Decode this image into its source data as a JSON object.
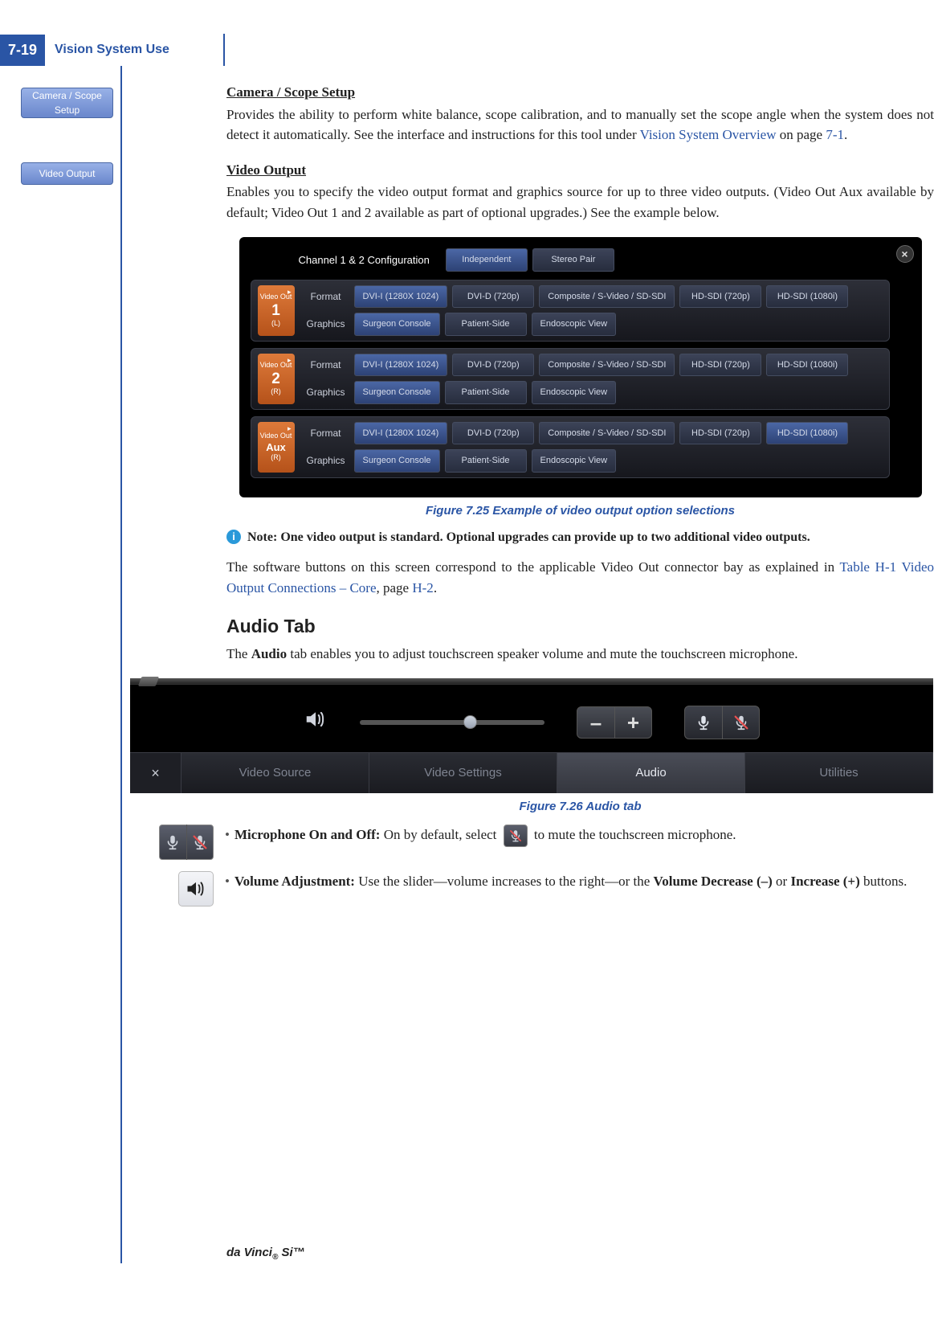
{
  "header": {
    "page_number": "7-19",
    "section": "Vision System Use"
  },
  "ui_buttons": {
    "camera_scope": "Camera / Scope Setup",
    "video_output": "Video Output"
  },
  "camera_block": {
    "heading": "Camera / Scope Setup",
    "text_before_link": "Provides the ability to perform white balance, scope calibration, and to manually set the scope angle when the system does not detect it automatically. See the interface and instructions for this tool under ",
    "link": "Vision System Overview",
    "text_mid": " on page ",
    "page_ref": "7-1",
    "text_after": "."
  },
  "video_block": {
    "heading": "Video Output",
    "text": "Enables you to specify the video output format and graphics source for up to three video outputs. (Video Out Aux available by default; Video Out 1 and 2 available as part of optional upgrades.) See the example below."
  },
  "video_panel": {
    "config_label": "Channel 1 & 2 Configuration",
    "config_options": [
      "Independent",
      "Stereo Pair"
    ],
    "channels": [
      {
        "badge_top": "Video Out",
        "badge_num": "1",
        "badge_sub": "(L)"
      },
      {
        "badge_top": "Video Out",
        "badge_num": "2",
        "badge_sub": "(R)"
      },
      {
        "badge_top": "Video Out",
        "badge_num": "Aux",
        "badge_sub": "(R)"
      }
    ],
    "row_labels": {
      "format": "Format",
      "graphics": "Graphics"
    },
    "format_options": [
      "DVI-I (1280X 1024)",
      "DVI-D (720p)",
      "Composite / S-Video / SD-SDI",
      "HD-SDI (720p)",
      "HD-SDI (1080i)"
    ],
    "graphics_options": [
      "Surgeon Console",
      "Patient-Side",
      "Endoscopic View"
    ],
    "close": "×"
  },
  "fig25_caption": "Figure 7.25 Example of video output option selections",
  "note": {
    "icon": "i",
    "text": "Note: One video output is standard. Optional upgrades can provide up to two additional video outputs."
  },
  "after_note": {
    "text_before": "The software buttons on this screen correspond to the applicable Video Out connector bay as explained in ",
    "link": "Table H-1 Video Output Connections – Core",
    "text_mid": ", page ",
    "page_ref": "H-2",
    "text_after": "."
  },
  "audio_section": {
    "heading": "Audio Tab",
    "intro_before": "The ",
    "intro_bold": "Audio",
    "intro_after": " tab enables you to adjust touchscreen speaker volume and mute the touchscreen microphone."
  },
  "audio_panel": {
    "vol_minus": "–",
    "vol_plus": "+",
    "close": "×",
    "tabs": [
      "Video Source",
      "Video Settings",
      "Audio",
      "Utilities"
    ],
    "active_tab_index": 2
  },
  "fig26_caption": "Figure 7.26 Audio tab",
  "bullets": {
    "mic": {
      "label": "Microphone On and Off:",
      "before": " On by default, select ",
      "after": " to mute the touchscreen microphone."
    },
    "vol": {
      "label": "Volume Adjustment:",
      "before": " Use the slider—volume increases to the right—or the ",
      "bold2": "Volume Decrease (–)",
      "mid": " or ",
      "bold3": "Increase (+)",
      "after": " buttons."
    }
  },
  "footer": {
    "brand": "da Vinci",
    "suffix": " Si™",
    "reg": "®"
  }
}
